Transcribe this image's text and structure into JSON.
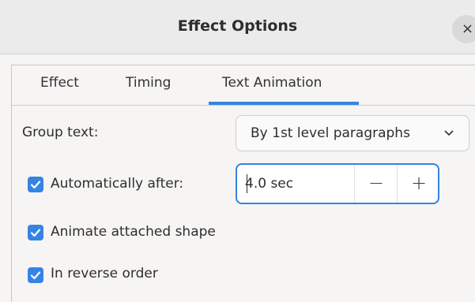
{
  "window": {
    "title": "Effect Options",
    "close_glyph": "×"
  },
  "tabs": [
    {
      "label": "Effect",
      "active": false
    },
    {
      "label": "Timing",
      "active": false
    },
    {
      "label": "Text Animation",
      "active": true
    }
  ],
  "group_text": {
    "label": "Group text:",
    "selected": "By 1st level paragraphs"
  },
  "automatically_after": {
    "label": "Automatically after:",
    "checked": true,
    "value": "4.0 sec",
    "decrement_glyph": "−",
    "increment_glyph": "+"
  },
  "animate_attached_shape": {
    "label": "Animate attached shape",
    "checked": true
  },
  "in_reverse_order": {
    "label": "In reverse order",
    "checked": true
  },
  "colors": {
    "accent": "#3584e4",
    "titlebar": "#ebebeb",
    "background": "#f6f5f4"
  },
  "icons": {
    "close": "close-icon",
    "dropdown": "chevron-down-icon",
    "check": "checkmark-icon"
  }
}
